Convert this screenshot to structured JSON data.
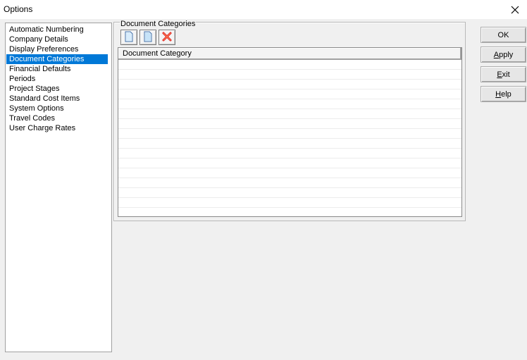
{
  "window": {
    "title": "Options"
  },
  "categories": [
    "Automatic Numbering",
    "Company Details",
    "Display Preferences",
    "Document Categories",
    "Financial Defaults",
    "Periods",
    "Project Stages",
    "Standard Cost Items",
    "System Options",
    "Travel Codes",
    "User Charge Rates"
  ],
  "selected_category": "Document Categories",
  "panel": {
    "group_label": "Document Categories",
    "toolbar": [
      "new-document-icon",
      "copy-document-icon",
      "delete-icon"
    ],
    "grid": {
      "columns": [
        "Document Category"
      ],
      "rows": []
    }
  },
  "buttons": {
    "ok": "OK",
    "apply": "Apply",
    "exit": "Exit",
    "help": "Help"
  },
  "colors": {
    "selection": "#0078d7",
    "delete": "#e02020"
  }
}
